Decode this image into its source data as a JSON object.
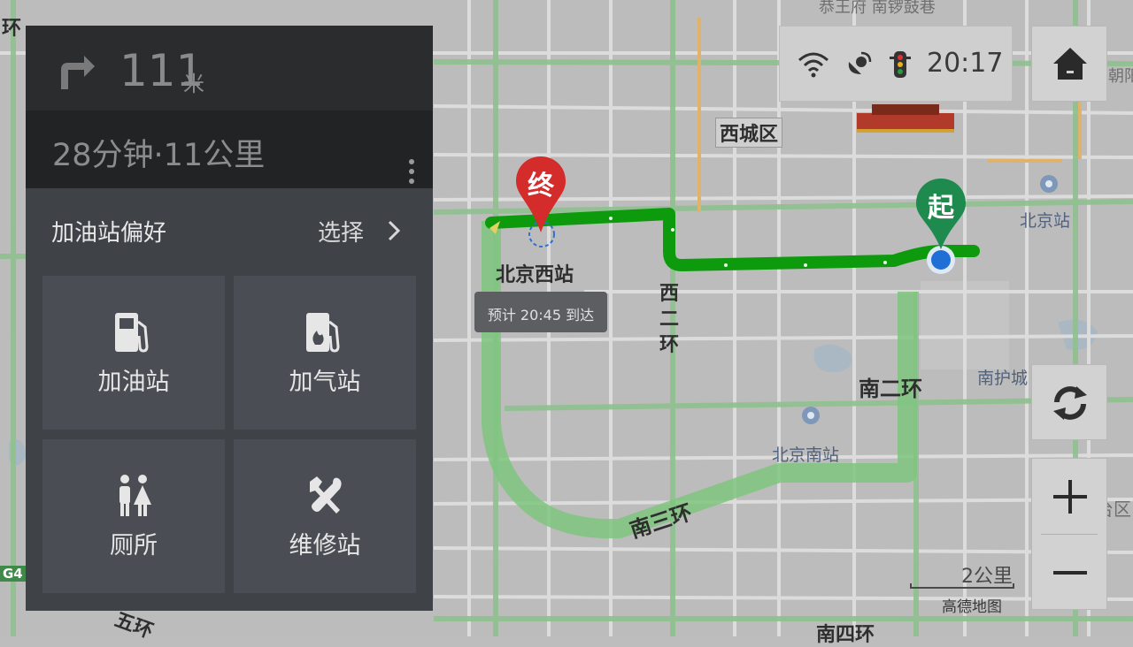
{
  "navigation": {
    "turn_icon": "turn-right-arrow-icon",
    "distance_value": "111",
    "distance_unit": "米",
    "route_summary": "28分钟·11公里"
  },
  "poi_panel": {
    "title": "加油站偏好",
    "choose_label": "选择",
    "tiles": [
      {
        "label": "加油站",
        "icon": "gas-station-icon"
      },
      {
        "label": "加气站",
        "icon": "gas-refill-station-icon"
      },
      {
        "label": "厕所",
        "icon": "toilet-icon"
      },
      {
        "label": "维修站",
        "icon": "repair-station-icon"
      }
    ]
  },
  "status_bar": {
    "time": "20:17",
    "icons": [
      "wifi-icon",
      "gps-satellite-icon",
      "traffic-light-icon"
    ]
  },
  "map": {
    "labels": {
      "xicheng": "西城区",
      "beijing_west": "北京西站",
      "west_second_ring": "西二环",
      "south_second_ring": "南二环",
      "beijing_south": "北京南站",
      "beijing_station": "北京站",
      "south_third_ring": "南三环",
      "south_moat": "南护城",
      "south_fourth_ring": "南四环",
      "top_street": "恭王府 南锣鼓巷",
      "chaoyang_edge": "朝阳",
      "fengtai_edge": "台区",
      "g4": "G4",
      "ring_left": "环",
      "fifth_ring": "五环"
    },
    "eta": "预计 20:45 到达",
    "end_marker": "终",
    "start_marker": "起",
    "scale_text": "2公里",
    "brand": "高德地图"
  },
  "colors": {
    "route_green": "#0d9a0d",
    "panel_dark": "#2b2c2e",
    "panel_body": "#3f4247",
    "tile": "#4a4d53",
    "end_marker": "#d42b2b",
    "start_marker": "#1e8a4e",
    "location_dot": "#1f6fd6"
  }
}
